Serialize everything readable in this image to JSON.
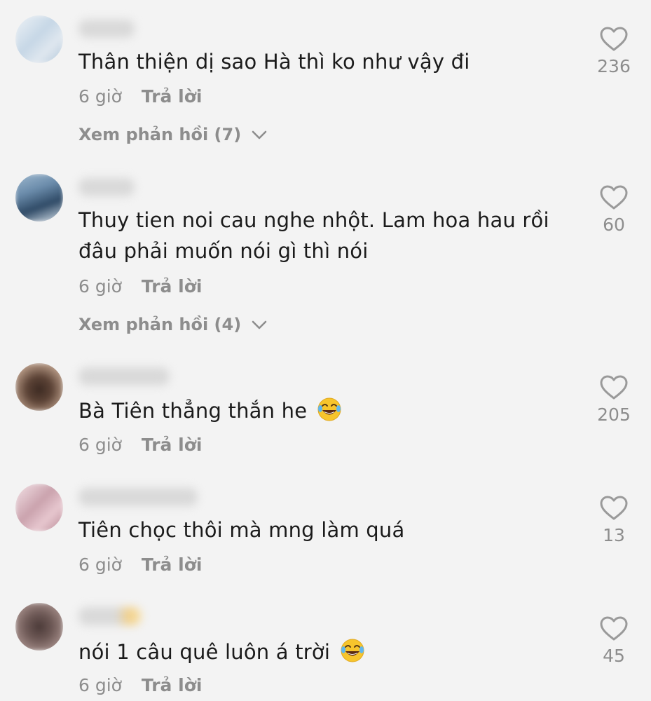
{
  "comments": [
    {
      "text": "Thân thiện dị sao Hà thì ko như vậy đi",
      "time": "6 giờ",
      "reply_label": "Trả lời",
      "view_replies": "Xem phản hồi (7)",
      "likes": "236",
      "avatar_colors": [
        "#dfe7ef",
        "#c6d7e6",
        "#eef2f6"
      ]
    },
    {
      "text": "Thuy tien noi cau nghe nhột. Lam hoa hau rồi đâu phải muốn nói gì thì nói",
      "time": "6 giờ",
      "reply_label": "Trả lời",
      "view_replies": "Xem phản hồi (4)",
      "likes": "60",
      "avatar_colors": [
        "#2f4a66",
        "#6b8cab",
        "#9fb9cf"
      ]
    },
    {
      "text": "Bà Tiên thẳng thắn he",
      "emoji": "laughing-tears",
      "time": "6 giờ",
      "reply_label": "Trả lời",
      "likes": "205",
      "avatar_colors": [
        "#5c4336",
        "#b79a86",
        "#3c2a22"
      ]
    },
    {
      "text": "Tiên chọc thôi mà mng làm quá",
      "time": "6 giờ",
      "reply_label": "Trả lời",
      "likes": "13",
      "avatar_colors": [
        "#e7c7cf",
        "#caa2ad",
        "#f4e3e7"
      ]
    },
    {
      "text": "nói 1 câu quê luôn á trời",
      "emoji": "laughing-tears",
      "time": "6 giờ",
      "reply_label": "Trả lời",
      "likes": "45",
      "avatar_colors": [
        "#6f5a57",
        "#a58e8a",
        "#4b3a38"
      ]
    }
  ],
  "colors": {
    "background": "#f3f3f3",
    "text": "#1b1b1b",
    "secondary": "#8d8d8d",
    "heart_outline": "#9a9a9a"
  },
  "icons": {
    "like": "heart-outline-icon",
    "expand": "chevron-down-icon",
    "emoji": "face-with-tears-of-joy-icon"
  }
}
